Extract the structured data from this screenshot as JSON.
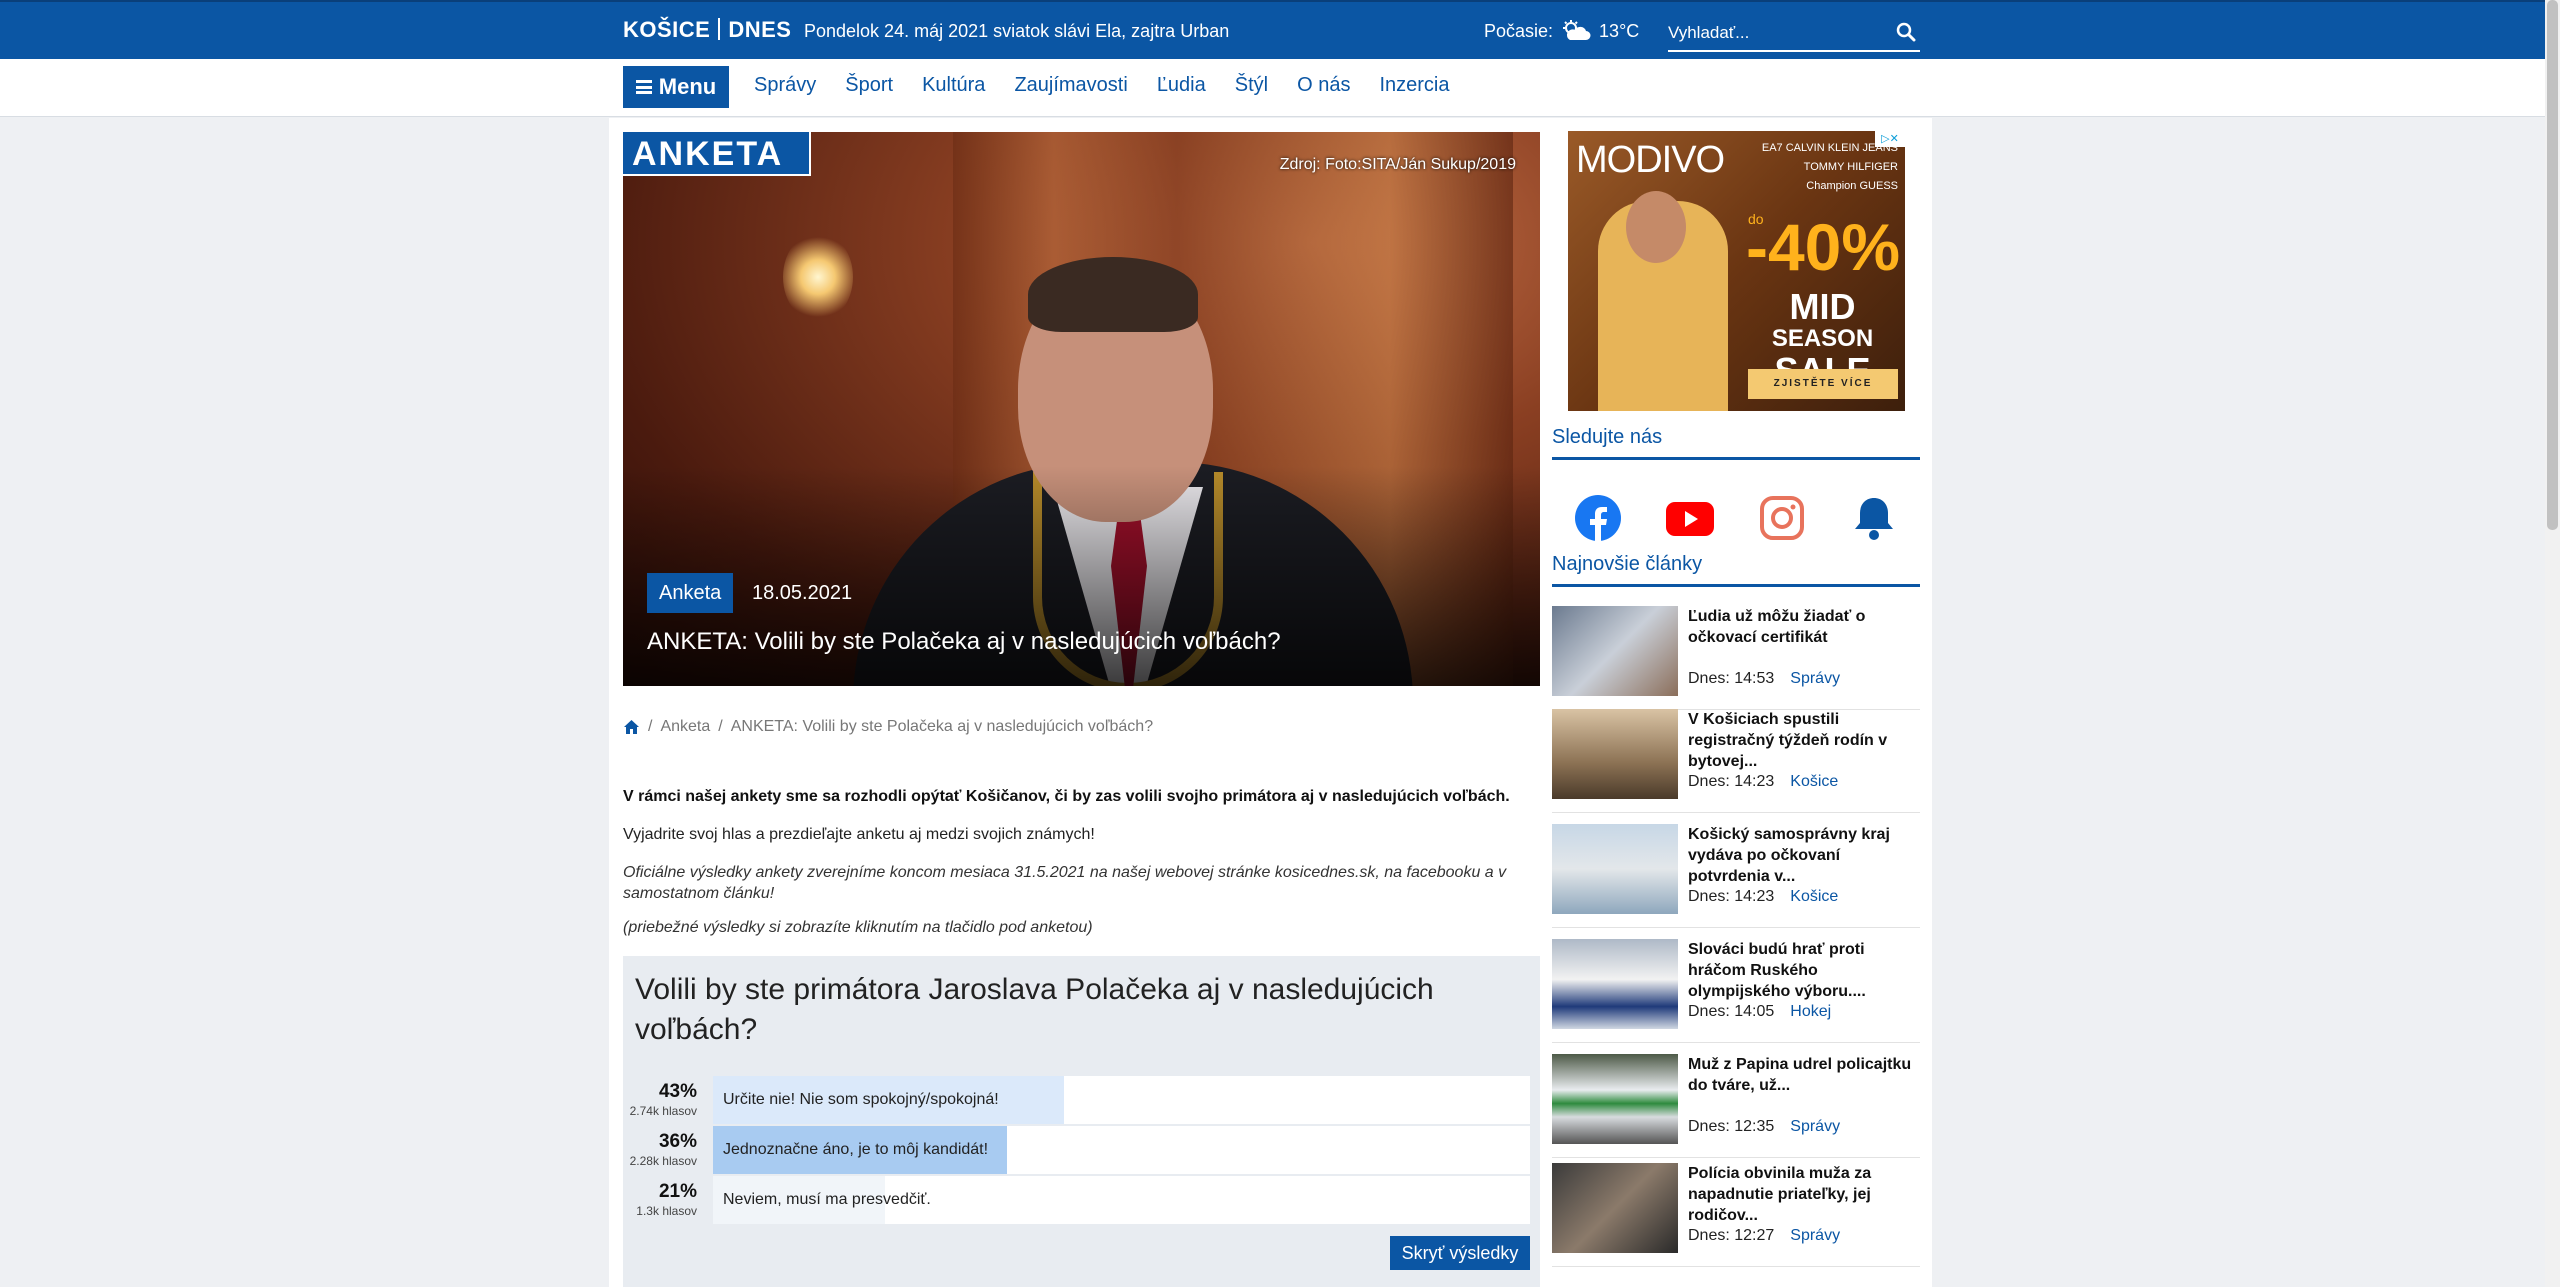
{
  "header": {
    "logo_left": "KOŠICE",
    "logo_right": "DNES",
    "dateline": "Pondelok 24. máj 2021 sviatok slávi Ela, zajtra Urban",
    "weather_label": "Počasie:",
    "weather_icon": "cloud-sun-icon",
    "temperature": "13°C",
    "search_placeholder": "Vyhladať..."
  },
  "nav": {
    "menu_label": "Menu",
    "links": [
      "Správy",
      "Šport",
      "Kultúra",
      "Zaujímavosti",
      "Ľudia",
      "Štýl",
      "O nás",
      "Inzercia"
    ]
  },
  "hero": {
    "badge": "ANKETA",
    "photo_credit": "Zdroj: Foto:SITA/Ján Sukup/2019",
    "category": "Anketa",
    "date": "18.05.2021",
    "title": "ANKETA: Volili by ste Polačeka aj v nasledujúcich voľbách?"
  },
  "breadcrumb": {
    "home_icon": "home-icon",
    "items": [
      "Anketa",
      "ANKETA: Volili by ste Polačeka aj v nasledujúcich voľbách?"
    ]
  },
  "article": {
    "lead": "V rámci našej ankety sme sa rozhodli opýtať Košičanov, či by zas volili svojho primátora aj v nasledujúcich voľbách.",
    "p1": "Vyjadrite svoj hlas a prezdieľajte anketu aj medzi svojich známych!",
    "p2": "Oficiálne výsledky ankety zverejníme koncom mesiaca 31.5.2021 na našej webovej stránke kosicednes.sk, na facebooku a v samostatnom článku!",
    "p3": "(priebežné výsledky si zobrazíte kliknutím na tlačidlo pod anketou)"
  },
  "poll": {
    "question": "Volili by ste primátora Jaroslava Polačeka aj v nasledujúcich voľbách?",
    "options": [
      {
        "pct": "43%",
        "votes": "2.74k hlasov",
        "label": "Určite nie! Nie som spokojný/spokojná!",
        "fraction": 0.43,
        "color": "#dbe9fa"
      },
      {
        "pct": "36%",
        "votes": "2.28k hlasov",
        "label": "Jednoznačne áno, je to môj kandidát!",
        "fraction": 0.36,
        "color": "#a8cbf1"
      },
      {
        "pct": "21%",
        "votes": "1.3k hlasov",
        "label": "Neviem, musí ma presvedčiť.",
        "fraction": 0.21,
        "color": "#f1f5f9"
      }
    ],
    "hide_button": "Skryť výsledky"
  },
  "ad": {
    "brand": "MODIVO",
    "logos": [
      "EA7   CALVIN KLEIN JEANS",
      "TOMMY HILFIGER",
      "Champion   GUESS"
    ],
    "pct_prefix": "do",
    "pct": "-40%",
    "sale_line1": "MID",
    "sale_line2": "SEASON",
    "sale_line3": "SALE",
    "cta": "ZJISTĚTE VÍCE"
  },
  "sidebar": {
    "follow_title": "Sledujte nás",
    "social": [
      "facebook-icon",
      "youtube-icon",
      "instagram-icon",
      "bell-icon"
    ],
    "latest_title": "Najnovšie články",
    "news": [
      {
        "title": "Ľudia už môžu žiadať o očkovací certifikát",
        "time": "Dnes: 14:53",
        "tag": "Správy"
      },
      {
        "title": "V Košiciach spustili registračný týždeň rodín v bytovej...",
        "time": "Dnes: 14:23",
        "tag": "Košice"
      },
      {
        "title": "Košický samosprávny kraj vydáva po očkovaní potvrdenia v...",
        "time": "Dnes: 14:23",
        "tag": "Košice"
      },
      {
        "title": "Slováci budú hrať proti hráčom Ruského olympijského výboru....",
        "time": "Dnes: 14:05",
        "tag": "Hokej"
      },
      {
        "title": "Muž z Papina udrel policajtku do tváre, už...",
        "time": "Dnes: 12:35",
        "tag": "Správy"
      },
      {
        "title": "Polícia obvinila muža za napadnutie priateľky, jej rodičov...",
        "time": "Dnes: 12:27",
        "tag": "Správy"
      }
    ]
  }
}
